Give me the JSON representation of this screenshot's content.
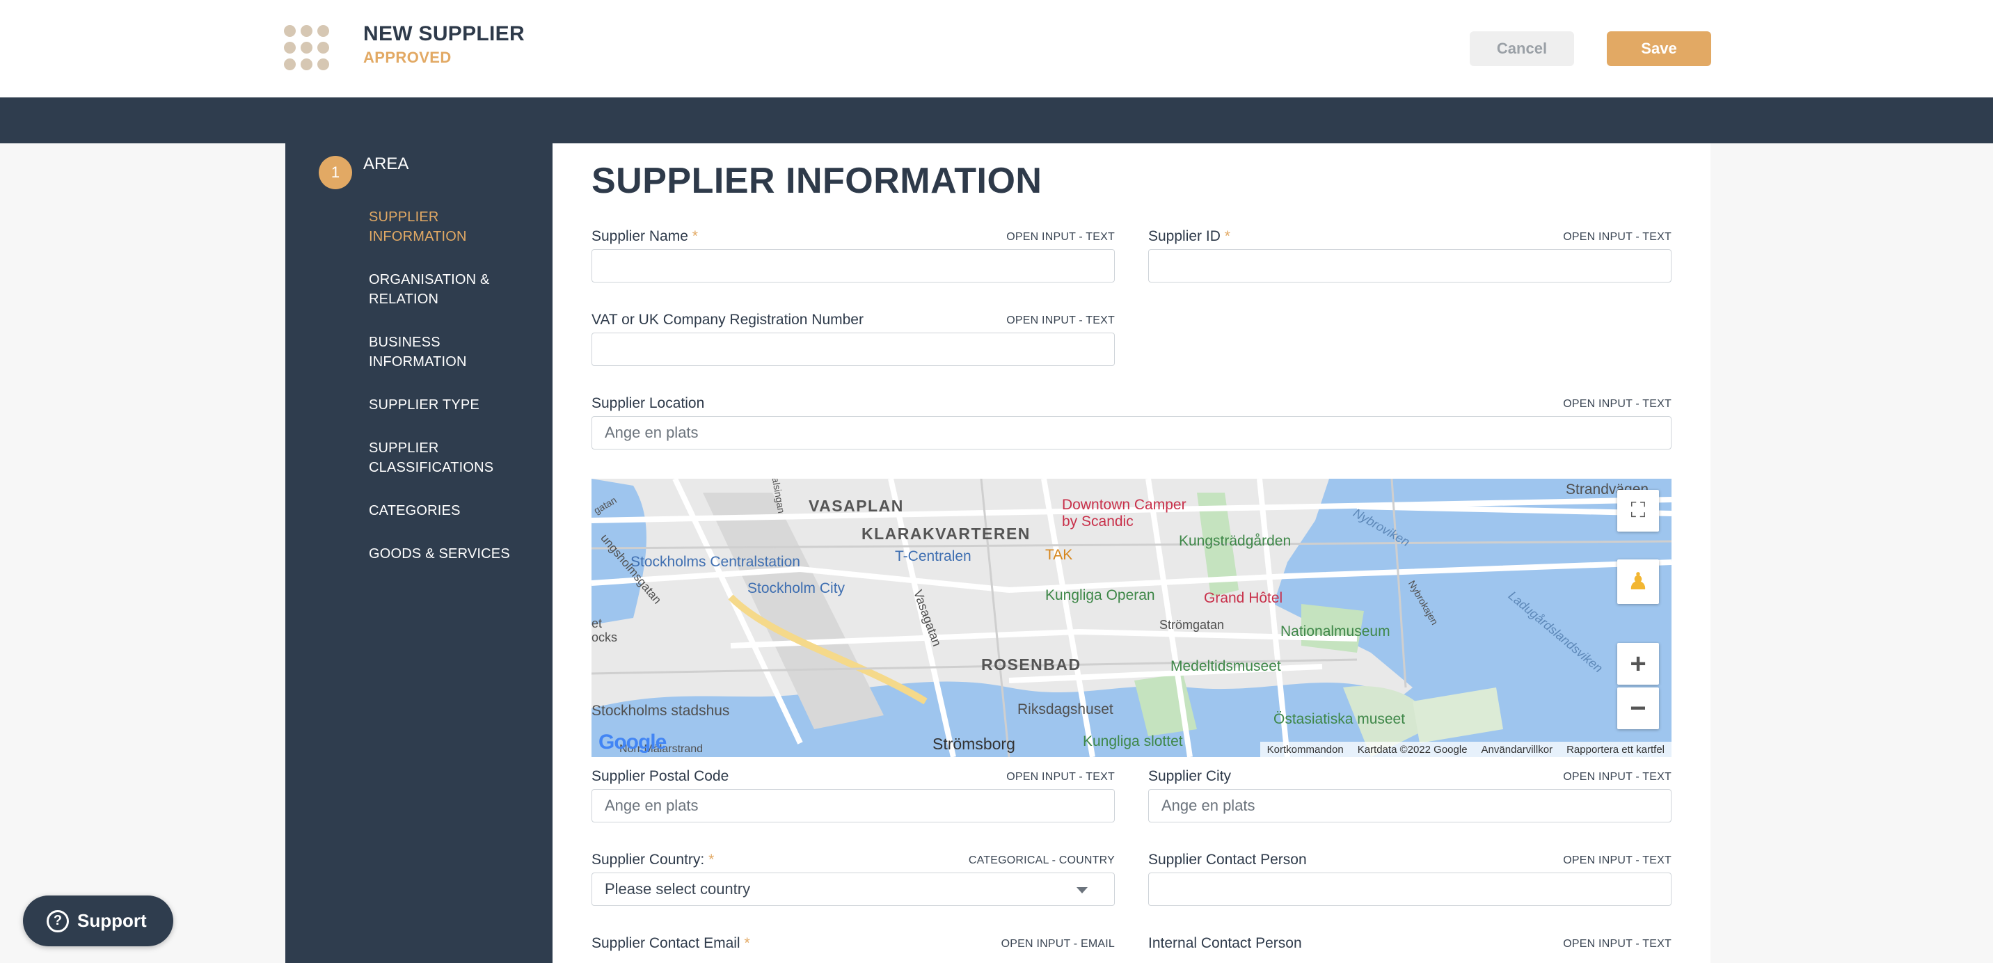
{
  "header": {
    "title": "NEW SUPPLIER",
    "subtitle": "APPROVED",
    "cancel_label": "Cancel",
    "save_label": "Save"
  },
  "sidebar": {
    "step_number": "1",
    "area_label": "AREA",
    "items": [
      {
        "label_line1": "SUPPLIER",
        "label_line2": "INFORMATION",
        "active": true
      },
      {
        "label_line1": "ORGANISATION &",
        "label_line2": "RELATION",
        "active": false
      },
      {
        "label_line1": "BUSINESS",
        "label_line2": "INFORMATION",
        "active": false
      },
      {
        "label_line1": "SUPPLIER TYPE",
        "label_line2": "",
        "active": false
      },
      {
        "label_line1": "SUPPLIER",
        "label_line2": "CLASSIFICATIONS",
        "active": false
      },
      {
        "label_line1": "CATEGORIES",
        "label_line2": "",
        "active": false
      },
      {
        "label_line1": "GOODS & SERVICES",
        "label_line2": "",
        "active": false
      }
    ]
  },
  "main": {
    "heading": "SUPPLIER INFORMATION",
    "fields": {
      "supplier_name": {
        "label": "Supplier Name",
        "required": "*",
        "type": "OPEN INPUT - TEXT",
        "value": "",
        "placeholder": ""
      },
      "supplier_id": {
        "label": "Supplier ID",
        "required": "*",
        "type": "OPEN INPUT - TEXT",
        "value": "",
        "placeholder": ""
      },
      "vat": {
        "label": "VAT or UK Company Registration Number",
        "type": "OPEN INPUT - TEXT",
        "value": "",
        "placeholder": ""
      },
      "location": {
        "label": "Supplier Location",
        "type": "OPEN INPUT - TEXT",
        "value": "",
        "placeholder": "Ange en plats"
      },
      "postal_code": {
        "label": "Supplier Postal Code",
        "type": "OPEN INPUT - TEXT",
        "value": "",
        "placeholder": "Ange en plats"
      },
      "city": {
        "label": "Supplier City",
        "type": "OPEN INPUT - TEXT",
        "value": "",
        "placeholder": "Ange en plats"
      },
      "country": {
        "label": "Supplier Country:",
        "required": "*",
        "type": "CATEGORICAL - COUNTRY",
        "selected": "Please select country"
      },
      "contact_person": {
        "label": "Supplier Contact Person",
        "type": "OPEN INPUT - TEXT",
        "value": "",
        "placeholder": ""
      },
      "contact_email": {
        "label": "Supplier Contact Email",
        "required": "*",
        "type": "OPEN INPUT - EMAIL"
      },
      "internal_contact": {
        "label": "Internal Contact Person",
        "type": "OPEN INPUT - TEXT"
      }
    }
  },
  "map": {
    "labels": {
      "vasaplan": "VASAPLAN",
      "klarakvarteren": "KLARAKVARTEREN",
      "rosenbad": "ROSENBAD",
      "centralstation": "Stockholms Centralstation",
      "tcentralen": "T-Centralen",
      "stockholm_city": "Stockholm City",
      "vasagatan": "Vasagatan",
      "downtown_camper_1": "Downtown Camper",
      "downtown_camper_2": "by Scandic",
      "tak": "TAK",
      "kungstradgarden": "Kungsträdgården",
      "kungliga_operan": "Kungliga Operan",
      "grand_hotel": "Grand Hôtel",
      "stromgatan": "Strömgatan",
      "nationalmuseum": "Nationalmuseum",
      "medeltidsmuseet": "Medeltidsmuseet",
      "riksdagshuset": "Riksdagshuset",
      "stadshus": "Stockholms stadshus",
      "stromsborg": "Strömsborg",
      "kungliga_slottet": "Kungliga slottet",
      "ostasiatiska": "Östasiatiska museet",
      "strandvagen": "Strandvägen",
      "nybroviken": "Nybroviken",
      "ladugardslandsviken": "Ladugårdslandsviken",
      "kungsholmsgatan": "ungsholmsgatan",
      "etocks": "et",
      "etocks2": "ocks",
      "malargatan": "Norr Mälarstrand",
      "nybrokajen": "Nybrokajen",
      "malsingan": "malsingan",
      "gatan": "gatan"
    },
    "footer": [
      "Kortkommandon",
      "Kartdata ©2022 Google",
      "Användarvillkor",
      "Rapportera ett kartfel"
    ],
    "google_logo": "Google"
  },
  "support": {
    "label": "Support"
  }
}
